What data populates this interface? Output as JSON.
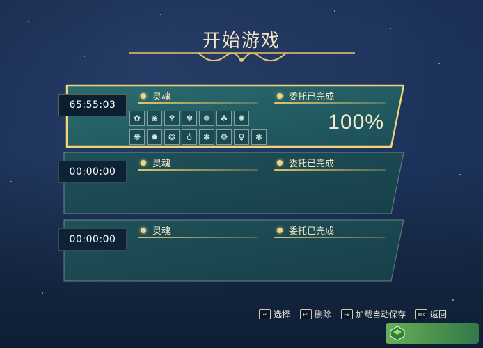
{
  "screen": {
    "title": "开始游戏"
  },
  "slots": [
    {
      "time": "65:55:03",
      "label_left": "灵魂",
      "label_right": "委托已完成",
      "percent": "100%",
      "selected": true,
      "soul_icons": [
        "✿",
        "❀",
        "♆",
        "✾",
        "❁",
        "☘",
        "✺",
        "❋",
        "✹",
        "❂",
        "♁",
        "✽",
        "☸",
        "♀",
        "❃"
      ]
    },
    {
      "time": "00:00:00",
      "label_left": "灵魂",
      "label_right": "委托已完成",
      "selected": false
    },
    {
      "time": "00:00:00",
      "label_left": "灵魂",
      "label_right": "委托已完成",
      "selected": false
    }
  ],
  "footer": {
    "items": [
      {
        "key": "↵",
        "label": "选择"
      },
      {
        "key": "F4",
        "label": "删除"
      },
      {
        "key": "F9",
        "label": "加载自动保存"
      },
      {
        "key": "esc",
        "label": "返回"
      }
    ]
  },
  "colors": {
    "gold": "#f0d489",
    "panel": "#18464f",
    "text": "#f3e6c6"
  }
}
